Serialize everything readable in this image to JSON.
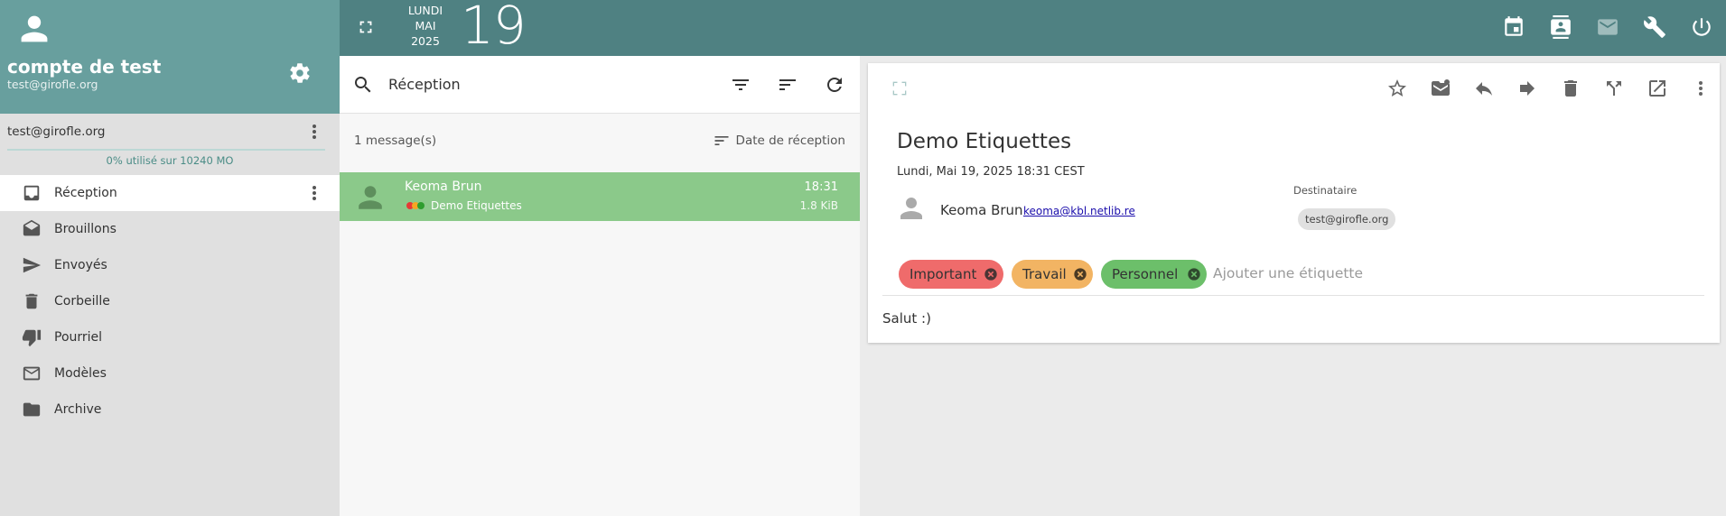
{
  "account": {
    "name": "compte de test",
    "email": "test@girofle.org",
    "row_email": "test@girofle.org",
    "quota": "0% utilisé sur 10240 MO"
  },
  "folders": [
    {
      "label": "Réception",
      "icon": "inbox-icon",
      "active": true
    },
    {
      "label": "Brouillons",
      "icon": "drafts-icon"
    },
    {
      "label": "Envoyés",
      "icon": "send-icon"
    },
    {
      "label": "Corbeille",
      "icon": "trash-icon"
    },
    {
      "label": "Pourriel",
      "icon": "thumb-down-icon"
    },
    {
      "label": "Modèles",
      "icon": "mail-icon"
    },
    {
      "label": "Archive",
      "icon": "folder-icon"
    }
  ],
  "topbar": {
    "day": "LUNDI",
    "month": "MAI",
    "year": "2025",
    "date_number": "19"
  },
  "list": {
    "title": "Réception",
    "count": "1 message(s)",
    "sort_label": "Date de réception",
    "messages": [
      {
        "from": "Keoma Brun",
        "subject": "Demo Etiquettes",
        "time": "18:31",
        "size": "1.8 KiB"
      }
    ]
  },
  "message": {
    "subject": "Demo Etiquettes",
    "datetime": "Lundi, Mai 19, 2025 18:31 CEST",
    "sender_name": "Keoma Brun",
    "sender_email": "keoma@kbl.netlib.re",
    "recipient_label": "Destinataire",
    "recipient": "test@girofle.org",
    "tags": [
      {
        "label": "Important",
        "color": "#ef6b6b"
      },
      {
        "label": "Travail",
        "color": "#f2b463"
      },
      {
        "label": "Personnel",
        "color": "#6cbf6a"
      }
    ],
    "tag_placeholder": "Ajouter une étiquette",
    "body": "Salut :)"
  },
  "colors": {
    "sidebar_header": "#689f9e",
    "topbar": "#4f8182",
    "selected_message": "#8bc98a"
  }
}
